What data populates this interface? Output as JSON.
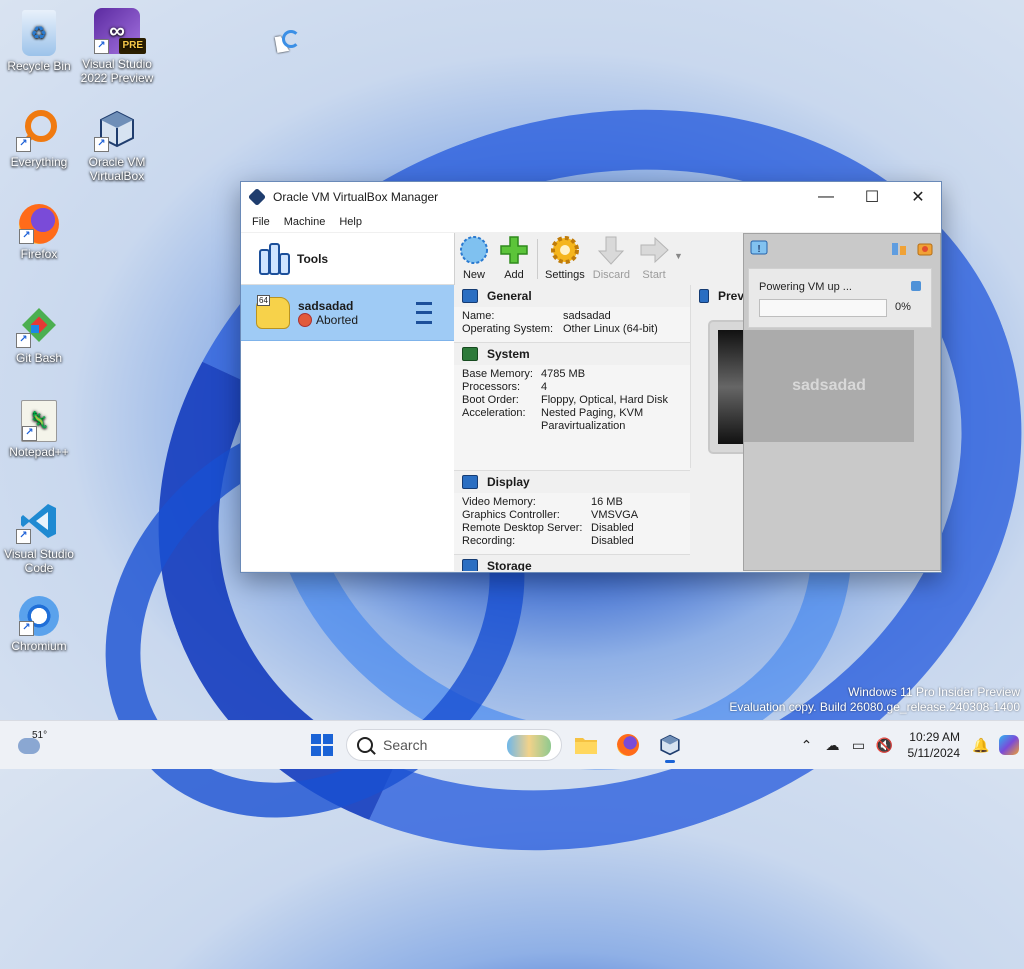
{
  "desktop": {
    "icons": [
      {
        "label": "Recycle Bin"
      },
      {
        "label": "Visual Studio 2022 Preview",
        "badge": "PRE"
      },
      {
        "label": "Everything"
      },
      {
        "label": "Oracle VM VirtualBox"
      },
      {
        "label": "Firefox"
      },
      {
        "label": "Git Bash"
      },
      {
        "label": "Notepad++"
      },
      {
        "label": "Visual Studio Code"
      },
      {
        "label": "Chromium"
      }
    ]
  },
  "window": {
    "title": "Oracle VM VirtualBox Manager",
    "menu": [
      "File",
      "Machine",
      "Help"
    ],
    "tools_label": "Tools",
    "vm": {
      "name": "sadsadad",
      "state": "Aborted",
      "os_badge": "64"
    },
    "toolbar": {
      "new": "New",
      "add": "Add",
      "settings": "Settings",
      "discard": "Discard",
      "start": "Start"
    },
    "general": {
      "title": "General",
      "rows": [
        {
          "k": "Name:",
          "v": "sadsadad"
        },
        {
          "k": "Operating System:",
          "v": "Other Linux (64-bit)"
        }
      ]
    },
    "system": {
      "title": "System",
      "rows": [
        {
          "k": "Base Memory:",
          "v": "4785 MB"
        },
        {
          "k": "Processors:",
          "v": "4"
        },
        {
          "k": "Boot Order:",
          "v": "Floppy, Optical, Hard Disk"
        },
        {
          "k": "Acceleration:",
          "v": "Nested Paging, KVM Paravirtualization"
        }
      ]
    },
    "display": {
      "title": "Display",
      "rows": [
        {
          "k": "Video Memory:",
          "v": "16 MB"
        },
        {
          "k": "Graphics Controller:",
          "v": "VMSVGA"
        },
        {
          "k": "Remote Desktop Server:",
          "v": "Disabled"
        },
        {
          "k": "Recording:",
          "v": "Disabled"
        }
      ]
    },
    "storage": {
      "title": "Storage"
    },
    "preview": {
      "title": "Prev"
    },
    "progress": {
      "label": "Powering VM up ...",
      "percent": "0%",
      "value": 0,
      "vm_name": "sadsadad"
    }
  },
  "watermark": {
    "line1": "Windows 11 Pro Insider Preview",
    "line2": "Evaluation copy. Build 26080.ge_release.240308-1400"
  },
  "taskbar": {
    "weather_temp": "51°",
    "search_placeholder": "Search",
    "time": "10:29 AM",
    "date": "5/11/2024"
  },
  "colors": {
    "accent": "#1a63d6",
    "vm_selected": "#9fcbf5",
    "aborted": "#e25a3a"
  }
}
